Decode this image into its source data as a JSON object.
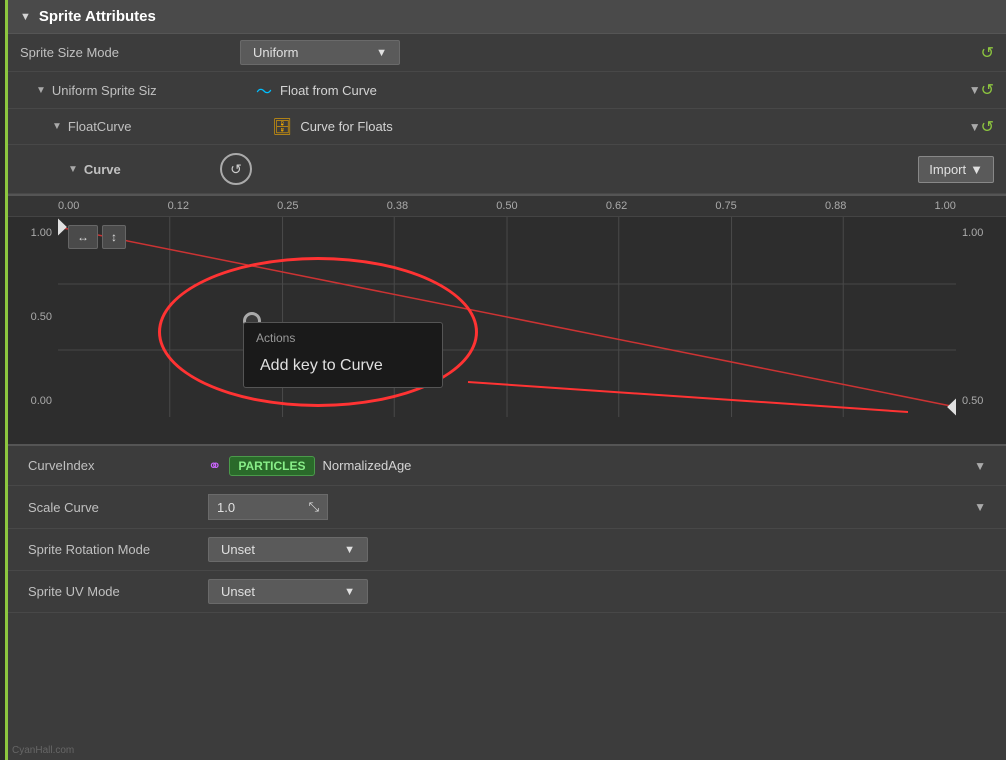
{
  "section": {
    "title": "Sprite Attributes",
    "triangle": "▼"
  },
  "properties": {
    "sprite_size_mode_label": "Sprite Size Mode",
    "sprite_size_mode_value": "Uniform",
    "uniform_sprite_size_label": "Uniform Sprite Siz",
    "uniform_sprite_size_value": "Float from Curve",
    "float_curve_label": "FloatCurve",
    "float_curve_value": "Curve for Floats",
    "curve_label": "Curve",
    "import_btn": "Import"
  },
  "graph": {
    "x_labels": [
      "0.00",
      "0.12",
      "0.25",
      "0.38",
      "0.50",
      "0.62",
      "0.75",
      "0.88",
      "1.00"
    ],
    "y_left_labels": [
      "1.00",
      "0.50",
      "0.00"
    ],
    "y_right_labels": [
      "1.00",
      "0.50"
    ],
    "tools": {
      "pan_h": "↔",
      "pan_v": "↕"
    }
  },
  "context_menu": {
    "header": "Actions",
    "item": "Add key to Curve"
  },
  "bottom": {
    "curve_index_label": "CurveIndex",
    "particles_badge": "PARTICLES",
    "normalized_age": "NormalizedAge",
    "scale_curve_label": "Scale Curve",
    "scale_curve_value": "1.0",
    "sprite_rotation_mode_label": "Sprite Rotation Mode",
    "sprite_rotation_mode_value": "Unset",
    "sprite_uv_mode_label": "Sprite UV Mode",
    "sprite_uv_mode_value": "Unset"
  },
  "watermark": "CyanHall.com",
  "colors": {
    "accent_green": "#8dc63f",
    "reset_green": "#8dc63f",
    "float_curve_blue": "#00bfff",
    "stack_yellow": "#f0a800",
    "link_purple": "#cc66ff",
    "particles_green_bg": "#2a6a2a",
    "red_highlight": "#ff3333"
  }
}
